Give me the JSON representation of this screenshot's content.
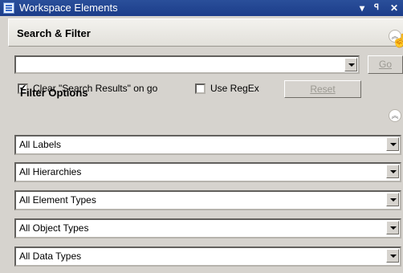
{
  "window": {
    "title": "Workspace Elements",
    "menu_glyph": "▾",
    "pin_glyph": "ᵖ",
    "close_glyph": "✕"
  },
  "search": {
    "section_label": "Search & Filter",
    "query_value": "",
    "go_label": "Go",
    "clear_label": "Clear \"Search Results\" on go",
    "clear_checked": true,
    "regex_label": "Use RegEx",
    "regex_checked": false,
    "reset_label": "Reset"
  },
  "filter": {
    "section_label": "Filter Options",
    "options": [
      "All Labels",
      "All Hierarchies",
      "All Element Types",
      "All Object Types",
      "All Data Types"
    ]
  },
  "icons": {
    "collapse": "double-chevron-up-icon",
    "cursor": "hand-pointer-icon"
  }
}
